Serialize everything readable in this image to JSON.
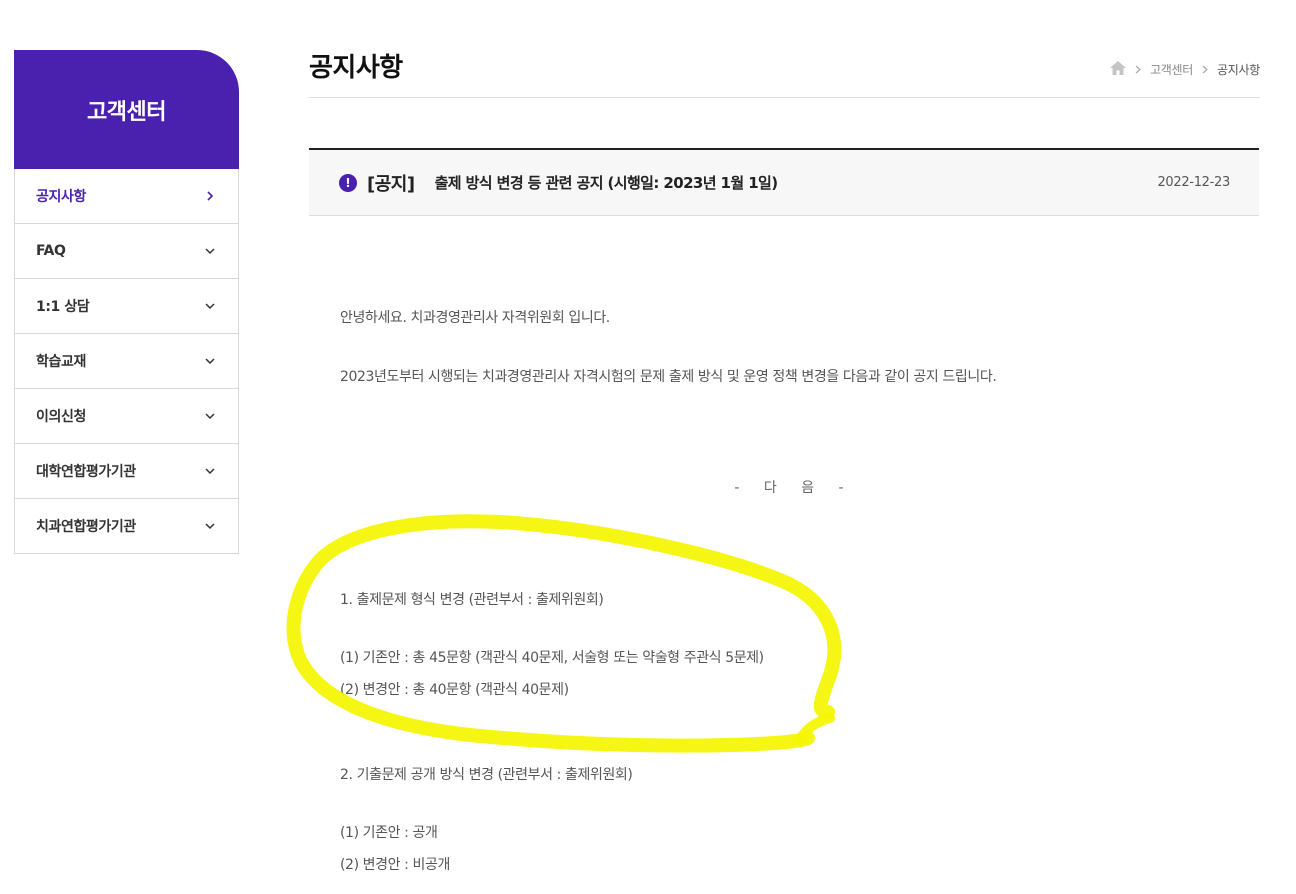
{
  "sidebar": {
    "title": "고객센터",
    "items": [
      {
        "label": "공지사항"
      },
      {
        "label": "FAQ"
      },
      {
        "label": "1:1 상담"
      },
      {
        "label": "학습교재"
      },
      {
        "label": "이의신청"
      },
      {
        "label": "대학연합평가기관"
      },
      {
        "label": "치과연합평가기관"
      }
    ]
  },
  "header": {
    "title": "공지사항",
    "breadcrumb": [
      "고객센터",
      "공지사항"
    ]
  },
  "notice": {
    "tag": "[공지]",
    "subject": "출제 방식 변경 등 관련 공지 (시행일: 2023년 1월 1일)",
    "date": "2022-12-23",
    "greeting": "안녕하세요. 치과경영관리사 자격위원회 입니다.",
    "intro": "2023년도부터 시행되는 치과경영관리사 자격시험의 문제 출제 방식 및 운영 정책 변경을 다음과 같이 공지 드립니다.",
    "separator": "- 다 음 -",
    "section1_title": "1. 출제문제 형식 변경 (관련부서 : 출제위원회)",
    "section1_item1": "(1) 기존안 : 총 45문항 (객관식 40문제, 서술형 또는 약술형 주관식 5문제)",
    "section1_item2": "(2) 변경안 : 총 40문항 (객관식 40문제)",
    "section2_title": "2. 기출문제 공개 방식 변경 (관련부서 : 출제위원회)",
    "section2_item1": "(1) 기존안 : 공개",
    "section2_item2": "(2) 변경안 : 비공개"
  },
  "colors": {
    "brand": "#4a21ae",
    "highlight": "#f5f500"
  }
}
